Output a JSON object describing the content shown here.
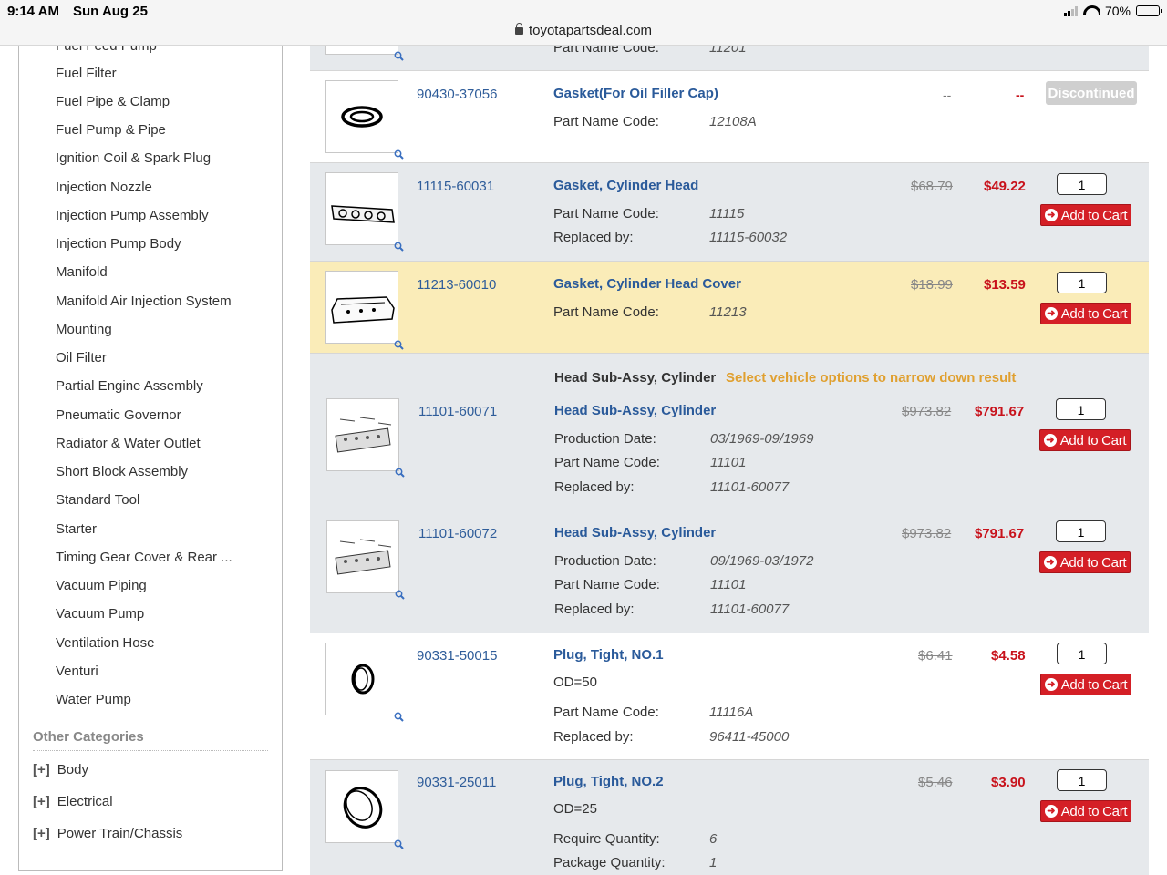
{
  "status": {
    "time": "9:14 AM",
    "date": "Sun Aug 25",
    "url": "toyotapartsdeal.com",
    "battery": "70%",
    "battery_level": 0.7
  },
  "sidebar": {
    "items": [
      "Fuel Feed Pump",
      "Fuel Filter",
      "Fuel Pipe & Clamp",
      "Fuel Pump & Pipe",
      "Ignition Coil & Spark Plug",
      "Injection Nozzle",
      "Injection Pump Assembly",
      "Injection Pump Body",
      "Manifold",
      "Manifold Air Injection System",
      "Mounting",
      "Oil Filter",
      "Partial Engine Assembly",
      "Pneumatic Governor",
      "Radiator & Water Outlet",
      "Short Block Assembly",
      "Standard Tool",
      "Starter",
      "Timing Gear Cover & Rear ...",
      "Vacuum Piping",
      "Vacuum Pump",
      "Ventilation Hose",
      "Venturi",
      "Water Pump"
    ],
    "other_header": "Other Categories",
    "categories": [
      {
        "plus": "[+]",
        "label": "Body"
      },
      {
        "plus": "[+]",
        "label": "Electrical"
      },
      {
        "plus": "[+]",
        "label": "Power Train/Chassis"
      }
    ]
  },
  "labels": {
    "part_name_code": "Part Name Code:",
    "replaced_by": "Replaced by:",
    "production_date": "Production Date:",
    "require_quantity": "Require Quantity:",
    "package_quantity": "Package Quantity:",
    "add_to_cart": "Add to Cart",
    "discontinued": "Discontinued"
  },
  "parts": {
    "top": {
      "code": "11201"
    },
    "p1": {
      "number": "90430-37056",
      "name": "Gasket(For Oil Filler Cap)",
      "code": "12108A",
      "old_price": "--",
      "new_price": "--"
    },
    "p2": {
      "number": "11115-60031",
      "name": "Gasket, Cylinder Head",
      "code": "11115",
      "replaced": "11115-60032",
      "old_price": "$68.79",
      "new_price": "$49.22",
      "qty": "1"
    },
    "p3": {
      "number": "11213-60010",
      "name": "Gasket, Cylinder Head Cover",
      "code": "11213",
      "old_price": "$18.99",
      "new_price": "$13.59",
      "qty": "1"
    },
    "group": {
      "title": "Head Sub-Assy, Cylinder",
      "hint": "Select vehicle options to narrow down result"
    },
    "p4": {
      "number": "11101-60071",
      "name": "Head Sub-Assy, Cylinder",
      "prod_date": "03/1969-09/1969",
      "code": "11101",
      "replaced": "11101-60077",
      "old_price": "$973.82",
      "new_price": "$791.67",
      "qty": "1"
    },
    "p5": {
      "number": "11101-60072",
      "name": "Head Sub-Assy, Cylinder",
      "prod_date": "09/1969-03/1972",
      "code": "11101",
      "replaced": "11101-60077",
      "old_price": "$973.82",
      "new_price": "$791.67",
      "qty": "1"
    },
    "p6": {
      "number": "90331-50015",
      "name": "Plug, Tight, NO.1",
      "note": "OD=50",
      "code": "11116A",
      "replaced": "96411-45000",
      "old_price": "$6.41",
      "new_price": "$4.58",
      "qty": "1"
    },
    "p7": {
      "number": "90331-25011",
      "name": "Plug, Tight, NO.2",
      "note": "OD=25",
      "require_qty": "6",
      "package_qty": "1",
      "old_price": "$5.46",
      "new_price": "$3.90",
      "qty": "1"
    }
  }
}
